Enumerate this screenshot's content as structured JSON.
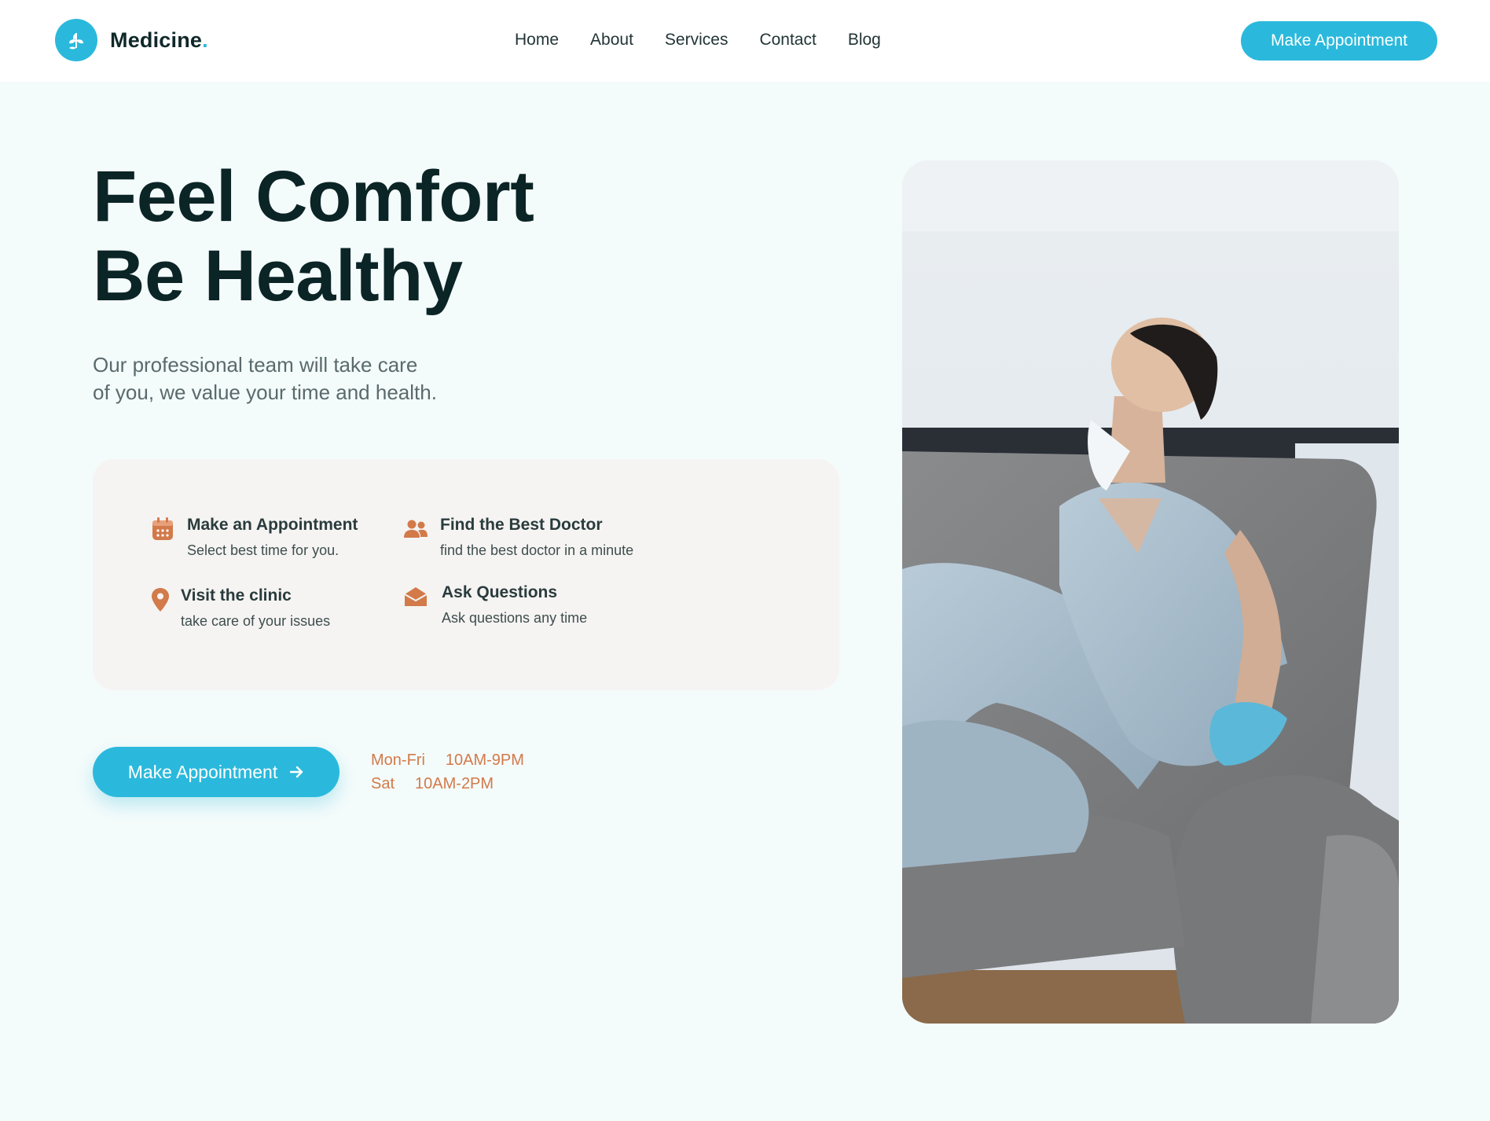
{
  "header": {
    "brand": "Medicine",
    "brand_dot": ".",
    "nav": [
      "Home",
      "About",
      "Services",
      "Contact",
      "Blog"
    ],
    "cta_label": "Make Appointment"
  },
  "hero": {
    "title_line1": "Feel Comfort",
    "title_line2": "Be Healthy",
    "subtitle_line1": "Our professional team will take care",
    "subtitle_line2": "of you, we value your time and health."
  },
  "features": [
    {
      "title": "Make an Appointment",
      "desc": "Select best time for you.",
      "icon": "calendar-icon"
    },
    {
      "title": "Find the Best Doctor",
      "desc": "find the best doctor in a minute",
      "icon": "users-icon"
    },
    {
      "title": "Visit the clinic",
      "desc": "take care of your issues",
      "icon": "map-pin-icon"
    },
    {
      "title": "Ask Questions",
      "desc": "Ask questions any time",
      "icon": "envelope-icon"
    }
  ],
  "cta": {
    "label": "Make Appointment",
    "icon": "arrow-right-icon"
  },
  "hours": [
    {
      "days": "Mon-Fri",
      "time": "10AM-9PM"
    },
    {
      "days": "Sat",
      "time": "10AM-2PM"
    }
  ],
  "colors": {
    "primary": "#2ab9dc",
    "accent": "#d27a4a",
    "heading": "#0b2426",
    "background": "#f4fbfb"
  }
}
